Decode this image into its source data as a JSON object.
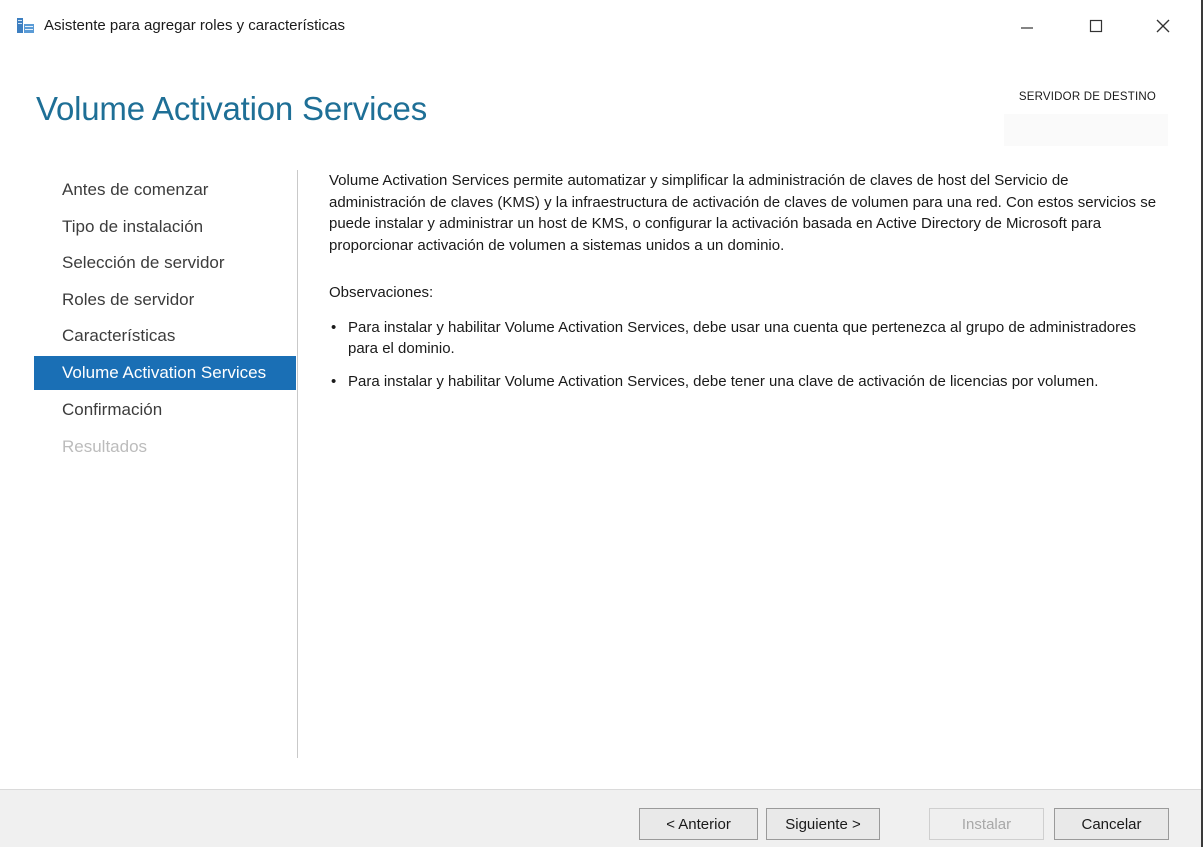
{
  "window": {
    "title": "Asistente para agregar roles y características"
  },
  "header": {
    "page_title": "Volume Activation Services",
    "destination_label": "SERVIDOR DE DESTINO",
    "destination_value": ""
  },
  "nav": {
    "items": [
      {
        "label": "Antes de comenzar",
        "state": "normal"
      },
      {
        "label": "Tipo de instalación",
        "state": "normal"
      },
      {
        "label": "Selección de servidor",
        "state": "normal"
      },
      {
        "label": "Roles de servidor",
        "state": "normal"
      },
      {
        "label": "Características",
        "state": "normal"
      },
      {
        "label": "Volume Activation Services",
        "state": "active"
      },
      {
        "label": "Confirmación",
        "state": "normal"
      },
      {
        "label": "Resultados",
        "state": "disabled"
      }
    ]
  },
  "content": {
    "intro": "Volume Activation Services permite automatizar y simplificar la administración de claves de host del Servicio de administración de claves (KMS) y la infraestructura de activación de claves de volumen para una red. Con estos servicios se puede instalar y administrar un host de KMS, o configurar la activación basada en Active Directory de Microsoft para proporcionar activación de volumen a sistemas unidos a un dominio.",
    "notes_heading": "Observaciones:",
    "bullet_symbol": "•",
    "notes": [
      "Para instalar y habilitar Volume Activation Services, debe usar una cuenta que pertenezca al grupo de administradores para el dominio.",
      "Para instalar y habilitar Volume Activation Services, debe tener una clave de activación de licencias por volumen."
    ]
  },
  "footer": {
    "prev_label": "< Anterior",
    "next_label": "Siguiente >",
    "install_label": "Instalar",
    "cancel_label": "Cancelar"
  },
  "colors": {
    "title_blue": "#1e6f96",
    "nav_active_bg": "#1a6fb5",
    "nav_disabled_text": "#bcbcbc",
    "footer_bg": "#f0f0f0"
  },
  "icons": {
    "app": "server-manager-icon",
    "minimize": "minimize-icon",
    "maximize": "maximize-icon",
    "close": "close-icon"
  }
}
